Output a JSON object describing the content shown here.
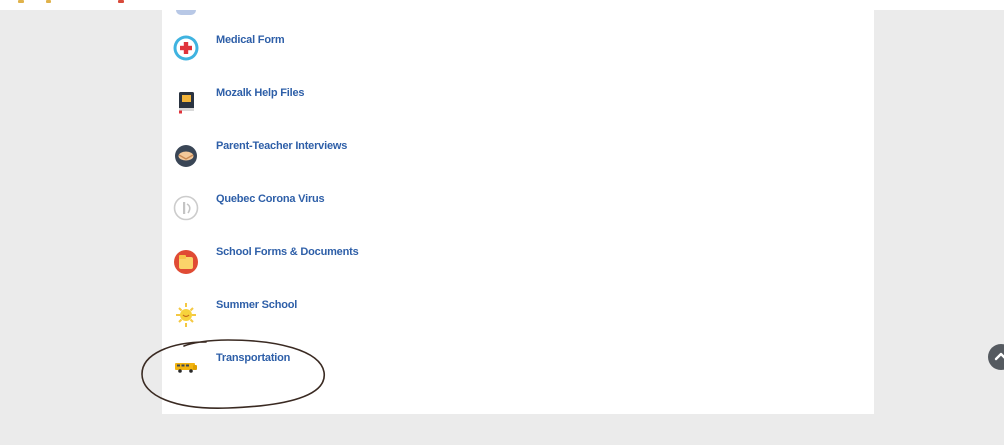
{
  "colors": {
    "page_background": "#ebebeb",
    "panel_background": "#ffffff",
    "link_text": "#2e5fa8",
    "annotation_ink": "#3a2a22",
    "scroll_button": "#555a60"
  },
  "links": [
    {
      "label": "Medical Form",
      "icon": "medical-cross-icon"
    },
    {
      "label": "Mozalk Help Files",
      "icon": "help-book-icon"
    },
    {
      "label": "Parent-Teacher Interviews",
      "icon": "handshake-icon"
    },
    {
      "label": "Quebec Corona Virus",
      "icon": "virus-info-icon"
    },
    {
      "label": "School Forms & Documents",
      "icon": "folder-icon"
    },
    {
      "label": "Summer School",
      "icon": "sun-icon"
    },
    {
      "label": "Transportation",
      "icon": "school-bus-icon"
    }
  ],
  "scroll_top_button": {
    "icon": "chevron-up-icon"
  },
  "annotation": {
    "shape": "hand-drawn-circle",
    "target": "Transportation"
  }
}
